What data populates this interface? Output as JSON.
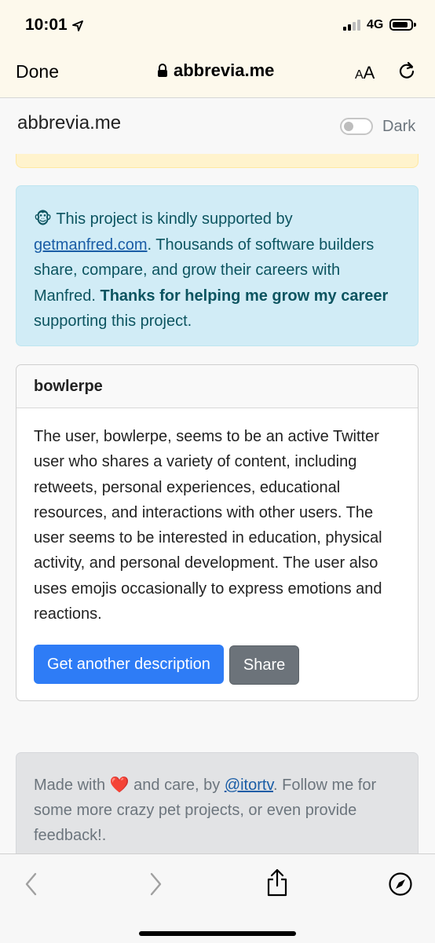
{
  "status_bar": {
    "time": "10:01",
    "network": "4G"
  },
  "browser": {
    "done_label": "Done",
    "url": "abbrevia.me",
    "text_size_small": "A",
    "text_size_big": "A"
  },
  "nav": {
    "brand": "abbrevia.me",
    "theme_toggle_label": "Dark"
  },
  "sponsor": {
    "emoji": "🐵",
    "text_before": "This project is kindly supported by",
    "link": "getmanfred.com",
    "text_after": ". Thousands of software builders share, compare, and grow their careers with Manfred.",
    "bold": "Thanks for helping me grow my career",
    "text_end": " supporting this project."
  },
  "result": {
    "username": "bowlerpe",
    "description": "The user, bowlerpe, seems to be an active Twitter user who shares a variety of content, including retweets, personal experiences, educational resources, and interactions with other users. The user seems to be interested in education, physical activity, and personal development. The user also uses emojis occasionally to express emotions and reactions.",
    "another_button": "Get another description",
    "share_button": "Share"
  },
  "footer": {
    "made_with": "Made with",
    "heart": "❤️",
    "and_care": " and care, by ",
    "author_link": "@itortv",
    "rest": ". Follow me for some more crazy pet projects, or even provide feedback!."
  },
  "colors": {
    "primary": "#2e7cf6",
    "secondary": "#6c737a",
    "info_bg": "#d1ecf6",
    "chrome_bg": "#fdf9ec"
  }
}
